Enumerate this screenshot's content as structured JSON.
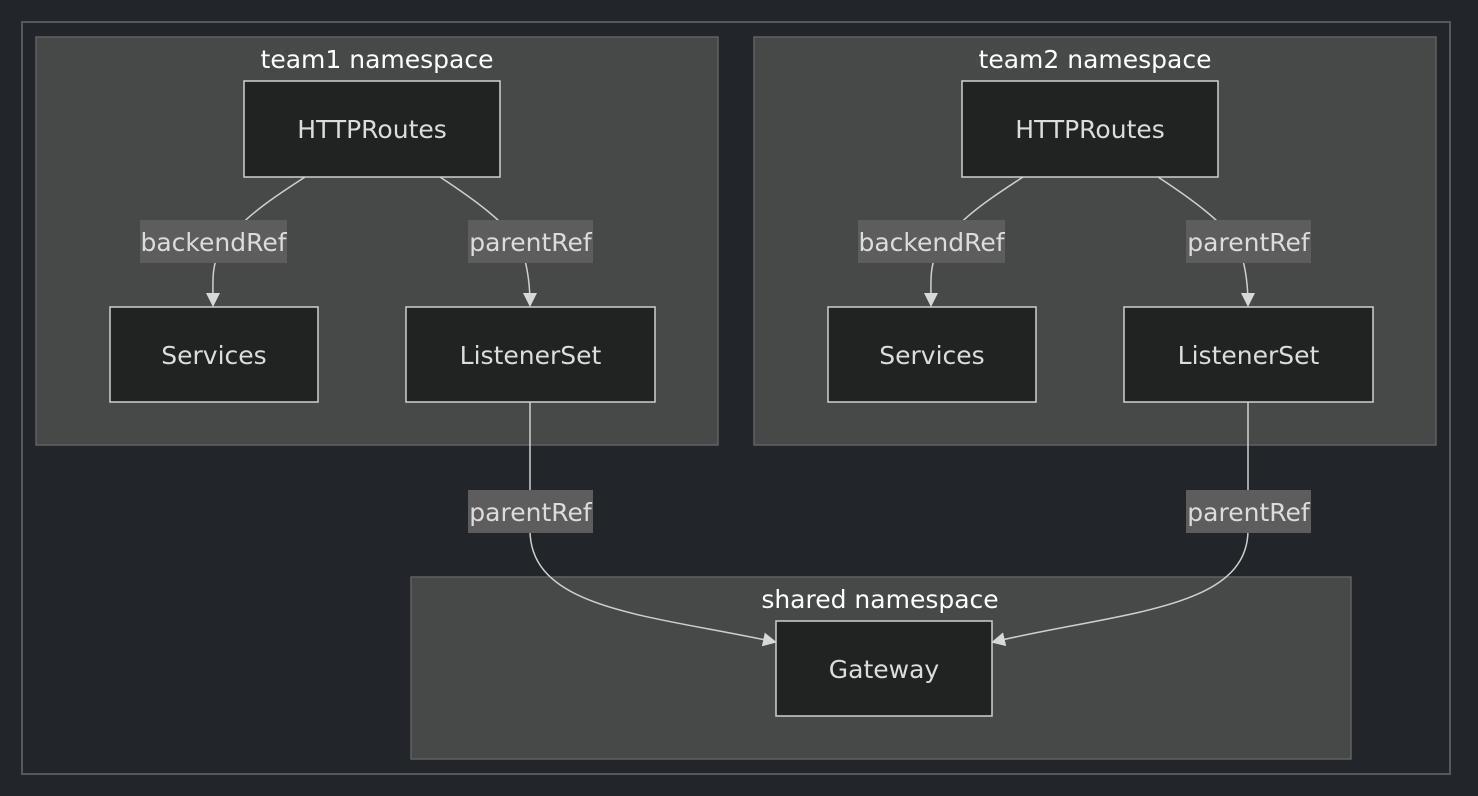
{
  "diagram": {
    "clusters": {
      "team1": {
        "title": "team1 namespace"
      },
      "team2": {
        "title": "team2 namespace"
      },
      "shared": {
        "title": "shared namespace"
      }
    },
    "nodes": {
      "team1_routes": "HTTPRoutes",
      "team1_services": "Services",
      "team1_listenerset": "ListenerSet",
      "team2_routes": "HTTPRoutes",
      "team2_services": "Services",
      "team2_listenerset": "ListenerSet",
      "gateway": "Gateway"
    },
    "edges": {
      "team1_backend": "backendRef",
      "team1_parent": "parentRef",
      "team2_backend": "backendRef",
      "team2_parent": "parentRef",
      "team1_to_gateway": "parentRef",
      "team2_to_gateway": "parentRef"
    },
    "colors": {
      "background": "#22252a",
      "cluster_fill": "#474948",
      "node_fill": "#212322",
      "node_stroke": "#cfd0d0",
      "edge_label_bg": "#5d5d5d"
    }
  }
}
